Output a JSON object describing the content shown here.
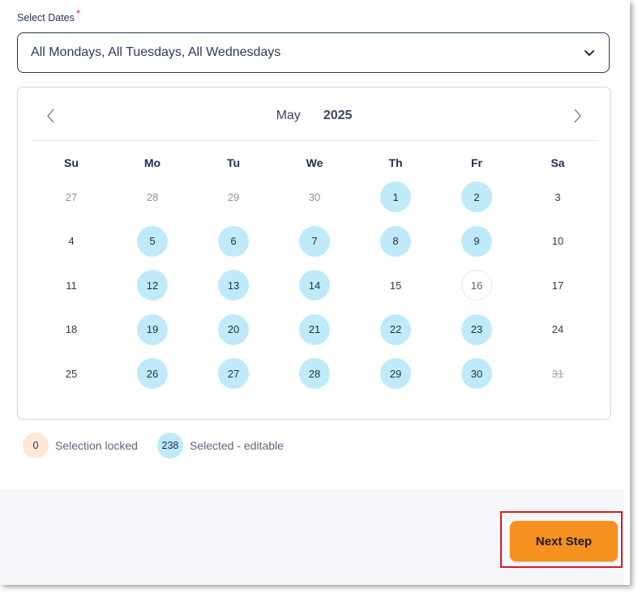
{
  "form": {
    "label": "Select Dates",
    "required_mark": "*",
    "select_value": "All Mondays, All Tuesdays, All Wednesdays"
  },
  "calendar": {
    "month": "May",
    "year": "2025",
    "weekdays": [
      "Su",
      "Mo",
      "Tu",
      "We",
      "Th",
      "Fr",
      "Sa"
    ],
    "weeks": [
      [
        {
          "d": "27",
          "s": "muted"
        },
        {
          "d": "28",
          "s": "muted"
        },
        {
          "d": "29",
          "s": "muted"
        },
        {
          "d": "30",
          "s": "muted"
        },
        {
          "d": "1",
          "s": "selected"
        },
        {
          "d": "2",
          "s": "selected"
        },
        {
          "d": "3",
          "s": "normal"
        }
      ],
      [
        {
          "d": "4",
          "s": "normal"
        },
        {
          "d": "5",
          "s": "selected"
        },
        {
          "d": "6",
          "s": "selected"
        },
        {
          "d": "7",
          "s": "selected"
        },
        {
          "d": "8",
          "s": "selected"
        },
        {
          "d": "9",
          "s": "selected"
        },
        {
          "d": "10",
          "s": "normal"
        }
      ],
      [
        {
          "d": "11",
          "s": "normal"
        },
        {
          "d": "12",
          "s": "selected"
        },
        {
          "d": "13",
          "s": "selected"
        },
        {
          "d": "14",
          "s": "selected"
        },
        {
          "d": "15",
          "s": "normal"
        },
        {
          "d": "16",
          "s": "today"
        },
        {
          "d": "17",
          "s": "normal"
        }
      ],
      [
        {
          "d": "18",
          "s": "normal"
        },
        {
          "d": "19",
          "s": "selected"
        },
        {
          "d": "20",
          "s": "selected"
        },
        {
          "d": "21",
          "s": "selected"
        },
        {
          "d": "22",
          "s": "selected"
        },
        {
          "d": "23",
          "s": "selected"
        },
        {
          "d": "24",
          "s": "normal"
        }
      ],
      [
        {
          "d": "25",
          "s": "normal"
        },
        {
          "d": "26",
          "s": "selected"
        },
        {
          "d": "27",
          "s": "selected"
        },
        {
          "d": "28",
          "s": "selected"
        },
        {
          "d": "29",
          "s": "selected"
        },
        {
          "d": "30",
          "s": "selected"
        },
        {
          "d": "31",
          "s": "strike"
        }
      ]
    ]
  },
  "legend": {
    "locked_count": "0",
    "locked_label": "Selection locked",
    "editable_count": "238",
    "editable_label": "Selected - editable"
  },
  "footer": {
    "next_label": "Next Step"
  },
  "colors": {
    "selected_bg": "#bfeaf9",
    "locked_bg": "#fde8d6",
    "button_bg": "#f6901e",
    "highlight_border": "#d31d27"
  }
}
